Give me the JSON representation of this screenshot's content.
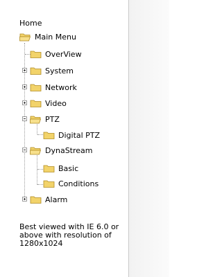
{
  "tree": {
    "home": "Home",
    "items": [
      {
        "label": "Main Menu",
        "state": "open"
      },
      {
        "label": "OverView",
        "state": "closed"
      },
      {
        "label": "System",
        "state": "closed",
        "expander": "plus"
      },
      {
        "label": "Network",
        "state": "closed",
        "expander": "plus"
      },
      {
        "label": "Video",
        "state": "closed",
        "expander": "plus"
      },
      {
        "label": "PTZ",
        "state": "open",
        "expander": "minus"
      },
      {
        "label": "Digital PTZ",
        "state": "closed"
      },
      {
        "label": "DynaStream",
        "state": "open",
        "expander": "minus"
      },
      {
        "label": "Basic",
        "state": "closed"
      },
      {
        "label": "Conditions",
        "state": "closed"
      },
      {
        "label": "Alarm",
        "state": "closed",
        "expander": "plus"
      }
    ]
  },
  "footer_note": "Best viewed with IE 6.0 or above with resolution of 1280x1024",
  "colors": {
    "folder": "#f2d36a",
    "folder_edge": "#b08b22",
    "tree_line": "#9a9a9a"
  },
  "icons": {
    "closed_folder": "folder-icon",
    "open_folder": "open-folder-icon",
    "plus": "expand-plus-icon",
    "minus": "collapse-minus-icon"
  }
}
